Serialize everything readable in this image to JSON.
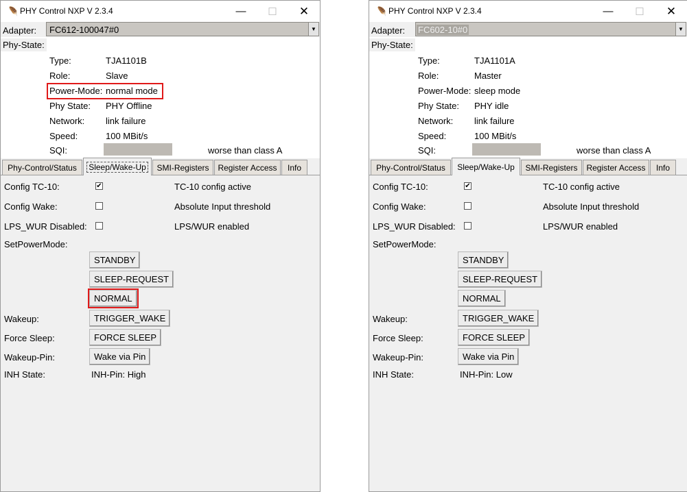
{
  "colors": {
    "highlight": "#e01919",
    "window_bg": "#f0f0f0"
  },
  "icons": {
    "app": "feather-icon",
    "minimize": "minimize-icon",
    "maximize": "maximize-icon",
    "close": "close-icon",
    "dropdown": "chevron-down-icon",
    "check": "checkmark-icon"
  },
  "left": {
    "title": "PHY Control NXP V 2.3.4",
    "adapter_label": "Adapter:",
    "adapter_value": "FC612-100047#0",
    "phy_state_label": "Phy-State:",
    "info": {
      "type_label": "Type:",
      "type_value": "TJA1101B",
      "role_label": "Role:",
      "role_value": "Slave",
      "power_label": "Power-Mode:",
      "power_value": "normal mode",
      "phystate_label": "Phy State:",
      "phystate_value": "PHY Offline",
      "network_label": "Network:",
      "network_value": "link failure",
      "speed_label": "Speed:",
      "speed_value": "100 MBit/s",
      "sqi_label": "SQI:",
      "sqi_text": "worse than class A"
    },
    "tabs": [
      "Phy-Control/Status",
      "Sleep/Wake-Up",
      "SMI-Registers",
      "Register Access",
      "Info"
    ],
    "body": {
      "config_tc10_label": "Config TC-10:",
      "config_tc10_desc": "TC-10 config active",
      "config_wake_label": "Config Wake:",
      "config_wake_desc": "Absolute Input threshold",
      "lps_label": "LPS_WUR Disabled:",
      "lps_desc": "LPS/WUR enabled",
      "setpower_label": "SetPowerMode:",
      "standby": "STANDBY",
      "sleep_request": "SLEEP-REQUEST",
      "normal": "NORMAL",
      "wakeup_label": "Wakeup:",
      "trigger_wake": "TRIGGER_WAKE",
      "force_sleep_label": "Force Sleep:",
      "force_sleep": "FORCE SLEEP",
      "wakeup_pin_label": "Wakeup-Pin:",
      "wake_via_pin": "Wake via Pin",
      "inh_label": "INH State:",
      "inh_value": "INH-Pin: High"
    }
  },
  "right": {
    "title": "PHY Control NXP V 2.3.4",
    "adapter_label": "Adapter:",
    "adapter_value": "FC602-10#0",
    "phy_state_label": "Phy-State:",
    "info": {
      "type_label": "Type:",
      "type_value": "TJA1101A",
      "role_label": "Role:",
      "role_value": "Master",
      "power_label": "Power-Mode:",
      "power_value": "sleep mode",
      "phystate_label": "Phy State:",
      "phystate_value": "PHY idle",
      "network_label": "Network:",
      "network_value": "link failure",
      "speed_label": "Speed:",
      "speed_value": "100 MBit/s",
      "sqi_label": "SQI:",
      "sqi_text": "worse than class A"
    },
    "tabs": [
      "Phy-Control/Status",
      "Sleep/Wake-Up",
      "SMI-Registers",
      "Register Access",
      "Info"
    ],
    "body": {
      "config_tc10_label": "Config TC-10:",
      "config_tc10_desc": "TC-10 config active",
      "config_wake_label": "Config Wake:",
      "config_wake_desc": "Absolute Input threshold",
      "lps_label": "LPS_WUR Disabled:",
      "lps_desc": "LPS/WUR enabled",
      "setpower_label": "SetPowerMode:",
      "standby": "STANDBY",
      "sleep_request": "SLEEP-REQUEST",
      "normal": "NORMAL",
      "wakeup_label": "Wakeup:",
      "trigger_wake": "TRIGGER_WAKE",
      "force_sleep_label": "Force Sleep:",
      "force_sleep": "FORCE SLEEP",
      "wakeup_pin_label": "Wakeup-Pin:",
      "wake_via_pin": "Wake via Pin",
      "inh_label": "INH State:",
      "inh_value": "INH-Pin: Low"
    }
  }
}
